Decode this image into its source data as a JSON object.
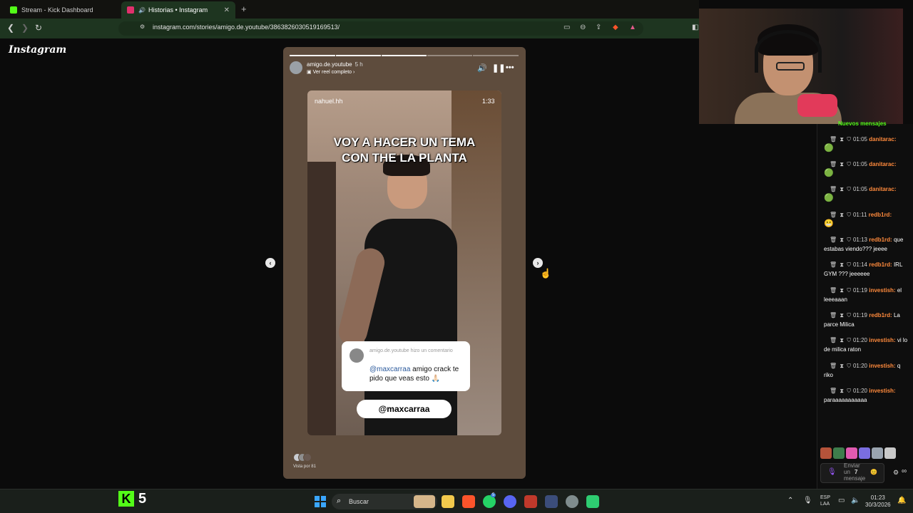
{
  "browser": {
    "tabs": [
      {
        "label": "Stream - Kick Dashboard",
        "favicon_color": "#53fc18"
      },
      {
        "label": "Historias • Instagram",
        "favicon_color": "#e1306c"
      }
    ],
    "new_tab": "+",
    "url": "instagram.com/stories/amigo.de.youtube/3863826030519169513/",
    "icons": [
      "back-icon",
      "forward-icon",
      "reload-icon",
      "bookmark-icon",
      "site-settings-icon",
      "cast-icon",
      "zoom-icon",
      "share-icon",
      "brave-shield-icon",
      "brave-rewards-icon"
    ]
  },
  "instagram": {
    "logo": "Instagram",
    "story": {
      "username": "amigo.de.youtube",
      "time": "5 h",
      "reel_link": "Ver reel completo",
      "progress": [
        1,
        1,
        0,
        0,
        0
      ],
      "reel": {
        "username": "nahuel.hh",
        "duration": "1:33",
        "title": "VOY A HACER UN TEMA\nCON THE LA PLANTA"
      },
      "comment": {
        "header": "amigo.de.youtube hizo un comentario",
        "mention": "@maxcarraa",
        "text": " amigo crack te pido que veas esto 🙏🏻"
      },
      "mention_tag": "@maxcarraa",
      "viewers_label": "Vista por 81"
    }
  },
  "chat": {
    "banner": "Nuevos mensajes",
    "messages": [
      {
        "time": "01:05",
        "user": "danitarac:",
        "text": "",
        "emote": "🟢"
      },
      {
        "time": "01:05",
        "user": "danitarac:",
        "text": "",
        "emote": "🟢"
      },
      {
        "time": "01:05",
        "user": "danitarac:",
        "text": "",
        "emote": "🟢"
      },
      {
        "time": "01:11",
        "user": "redb1rd:",
        "text": "",
        "emote": "😬"
      },
      {
        "time": "01:13",
        "user": "redb1rd:",
        "text": "que estabas viendo??? jeeee",
        "emote": ""
      },
      {
        "time": "01:14",
        "user": "redb1rd:",
        "text": "IRL GYM ??? jeeeeee",
        "emote": ""
      },
      {
        "time": "01:19",
        "user": "investish:",
        "text": "el leeeaaan",
        "emote": ""
      },
      {
        "time": "01:19",
        "user": "redb1rd:",
        "text": "La parce Milica",
        "emote": ""
      },
      {
        "time": "01:20",
        "user": "investish:",
        "text": "vi lo de milica raton",
        "emote": ""
      },
      {
        "time": "01:20",
        "user": "investish:",
        "text": "q riko",
        "emote": ""
      },
      {
        "time": "01:20",
        "user": "investish:",
        "text": "paraaaaaaaaaaa",
        "emote": ""
      }
    ],
    "input_placeholder": "Enviar un mensaje",
    "input_icon": "😊"
  },
  "taskbar": {
    "kick_badge": "K",
    "kick_count": "5",
    "search_label": "Buscar",
    "lang": "ESP\nLAA",
    "time": "01:23",
    "date": "30/3/2026",
    "whatsapp_badge": "5"
  }
}
